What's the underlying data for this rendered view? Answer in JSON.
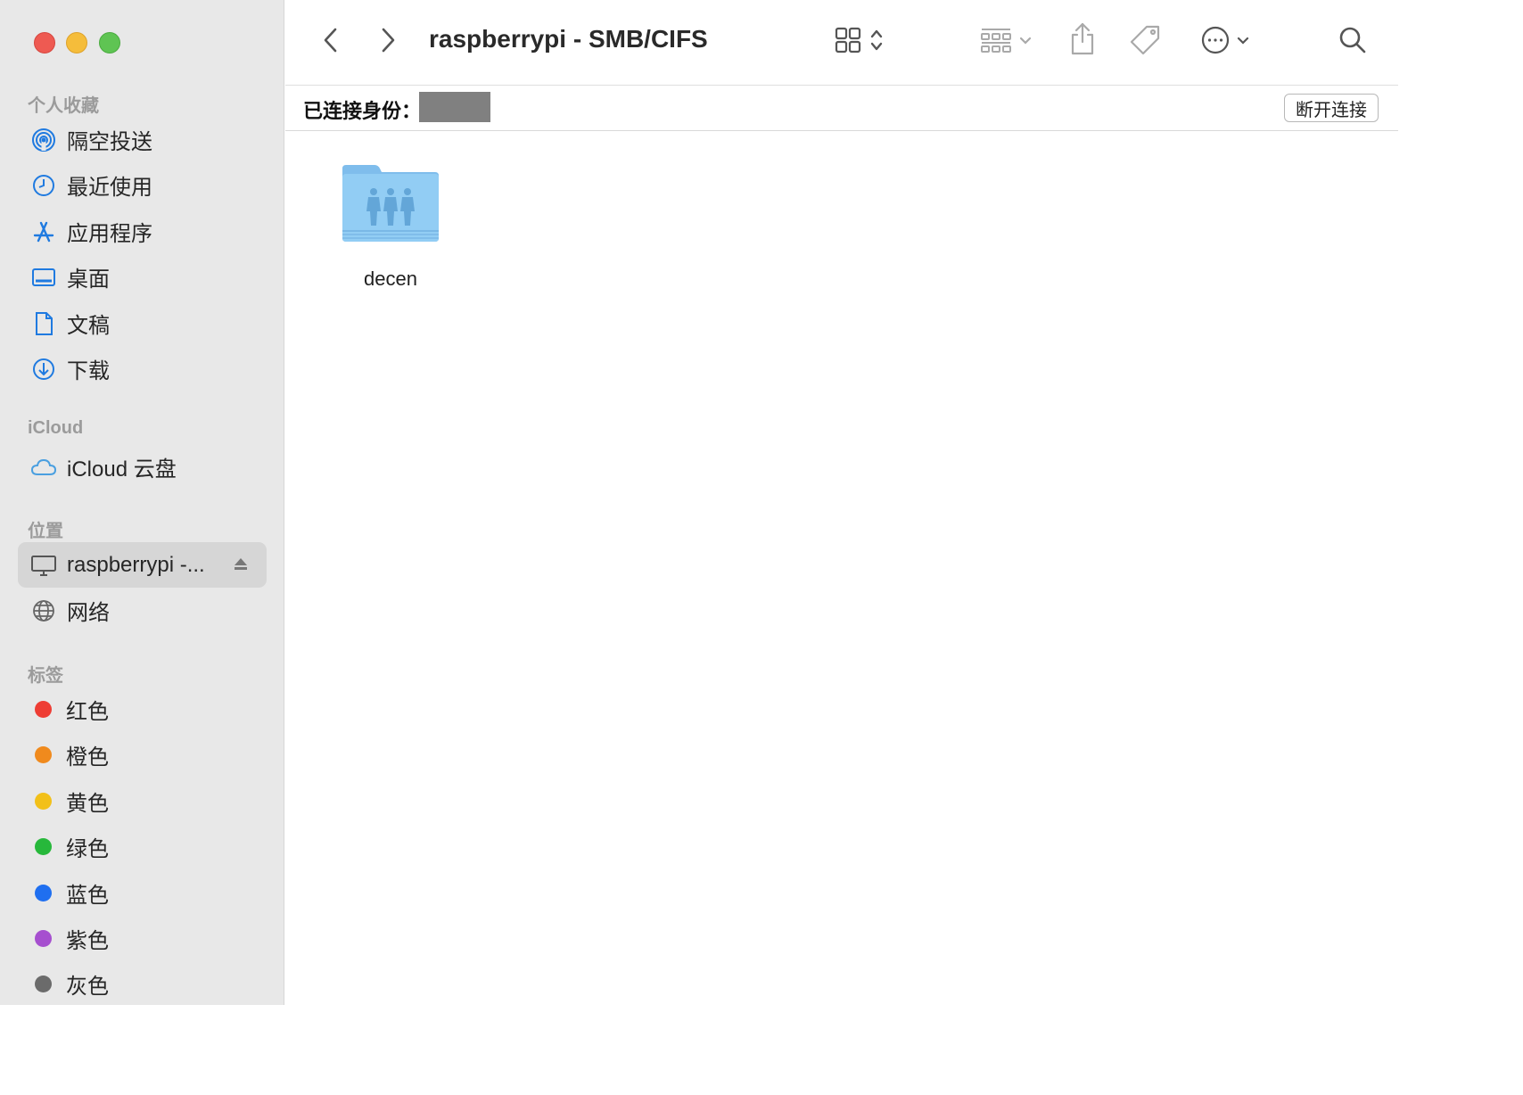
{
  "window": {
    "title": "raspberrypi - SMB/CIFS"
  },
  "sidebar": {
    "sections": {
      "favorites": "个人收藏",
      "icloud": "iCloud",
      "locations": "位置",
      "tags": "标签"
    },
    "favorites": [
      {
        "label": "隔空投送",
        "icon": "airdrop-icon"
      },
      {
        "label": "最近使用",
        "icon": "clock-icon"
      },
      {
        "label": "应用程序",
        "icon": "applications-icon"
      },
      {
        "label": "桌面",
        "icon": "desktop-icon"
      },
      {
        "label": "文稿",
        "icon": "document-icon"
      },
      {
        "label": "下载",
        "icon": "download-icon"
      }
    ],
    "icloud_items": [
      {
        "label": "iCloud 云盘",
        "icon": "cloud-icon"
      }
    ],
    "locations": [
      {
        "label": "raspberrypi -...",
        "icon": "computer-icon",
        "selected": true
      },
      {
        "label": "网络",
        "icon": "globe-icon"
      }
    ],
    "tags": [
      {
        "label": "红色",
        "color": "#ee3d34"
      },
      {
        "label": "橙色",
        "color": "#f08a1d"
      },
      {
        "label": "黄色",
        "color": "#f2c019"
      },
      {
        "label": "绿色",
        "color": "#27b83b"
      },
      {
        "label": "蓝色",
        "color": "#1f6ff0"
      },
      {
        "label": "紫色",
        "color": "#a64fcf"
      },
      {
        "label": "灰色",
        "color": "#6b6b6b"
      }
    ]
  },
  "connection": {
    "label": "已连接身份：",
    "disconnect_label": "断开连接"
  },
  "files": [
    {
      "name": "decen",
      "icon": "shared-folder-icon"
    }
  ],
  "colors": {
    "accent": "#1f7ae0",
    "sidebar_bg": "#e8e8e8",
    "selected_bg": "#d6d6d6",
    "folder": "#8ec8f2"
  }
}
